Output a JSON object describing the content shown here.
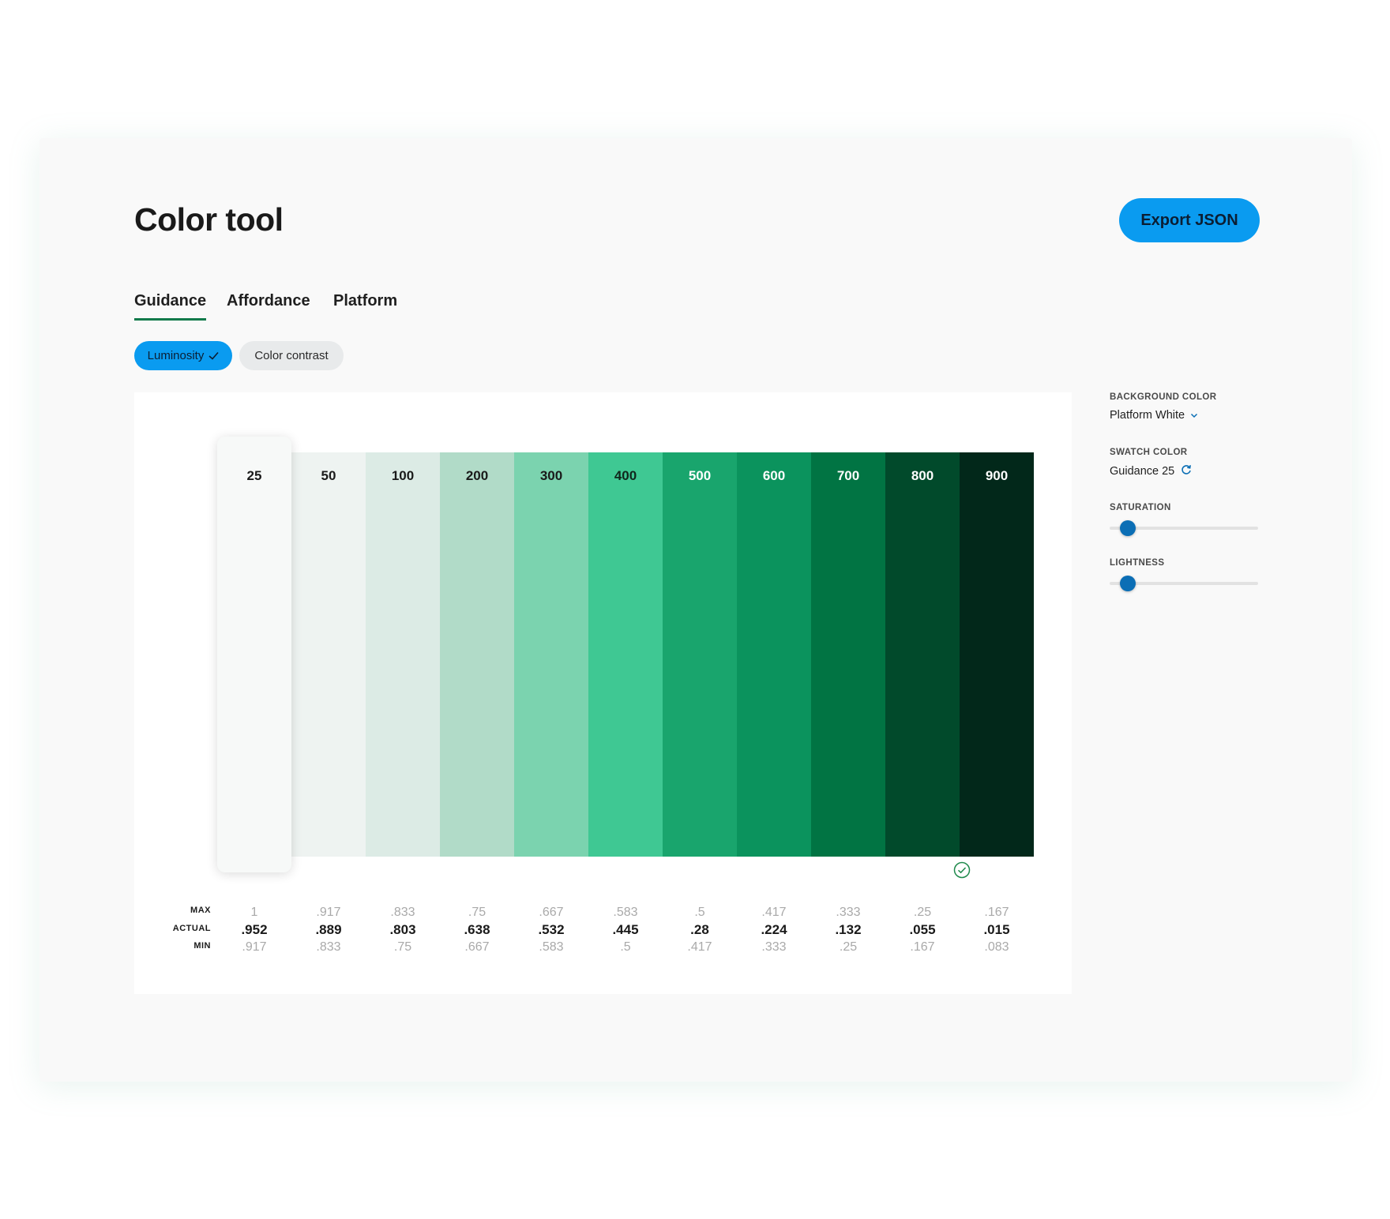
{
  "header": {
    "title": "Color tool",
    "export_label": "Export JSON"
  },
  "tabs": [
    {
      "label": "Guidance",
      "active": true
    },
    {
      "label": "Affordance",
      "active": false
    },
    {
      "label": "Platform",
      "active": false
    }
  ],
  "filters": {
    "luminosity_label": "Luminosity",
    "contrast_label": "Color contrast"
  },
  "colors": {
    "accent": "#0a9bf0",
    "tab_underline": "#117a4a",
    "slider_thumb": "#0b6eb5",
    "pass": "#1f8a4c"
  },
  "row_labels": {
    "max": "MAX",
    "actual": "ACTUAL",
    "min": "MIN"
  },
  "swatches": [
    {
      "label": "25",
      "color": "#f7f9f8",
      "text_color": "#1a1a1a",
      "max": "1",
      "actual": ".952",
      "min": ".917",
      "selected": true
    },
    {
      "label": "50",
      "color": "#eef3f1",
      "text_color": "#1a1a1a",
      "max": ".917",
      "actual": ".889",
      "min": ".833"
    },
    {
      "label": "100",
      "color": "#dcebe5",
      "text_color": "#1a1a1a",
      "max": ".833",
      "actual": ".803",
      "min": ".75"
    },
    {
      "label": "200",
      "color": "#b1dbc8",
      "text_color": "#1a1a1a",
      "max": ".75",
      "actual": ".638",
      "min": ".667"
    },
    {
      "label": "300",
      "color": "#7bd3af",
      "text_color": "#1a1a1a",
      "max": ".667",
      "actual": ".532",
      "min": ".583"
    },
    {
      "label": "400",
      "color": "#3fc893",
      "text_color": "#10261c",
      "max": ".583",
      "actual": ".445",
      "min": ".5"
    },
    {
      "label": "500",
      "color": "#19a56d",
      "text_color": "#ffffff",
      "max": ".5",
      "actual": ".28",
      "min": ".417"
    },
    {
      "label": "600",
      "color": "#0b935d",
      "text_color": "#ffffff",
      "max": ".417",
      "actual": ".224",
      "min": ".333"
    },
    {
      "label": "700",
      "color": "#017443",
      "text_color": "#ffffff",
      "max": ".333",
      "actual": ".132",
      "min": ".25"
    },
    {
      "label": "800",
      "color": "#014a2b",
      "text_color": "#ffffff",
      "max": ".25",
      "actual": ".055",
      "min": ".167"
    },
    {
      "label": "900",
      "color": "#02281a",
      "text_color": "#ffffff",
      "max": ".167",
      "actual": ".015",
      "min": ".083",
      "pass": true
    }
  ],
  "sidebar": {
    "background_color": {
      "label": "BACKGROUND COLOR",
      "value": "Platform White",
      "icon": "chevron-down-icon"
    },
    "swatch_color": {
      "label": "SWATCH COLOR",
      "value": "Guidance 25",
      "icon": "refresh-icon"
    },
    "saturation": {
      "label": "SATURATION",
      "value_fraction": 0.12
    },
    "lightness": {
      "label": "LIGHTNESS",
      "value_fraction": 0.12
    }
  }
}
